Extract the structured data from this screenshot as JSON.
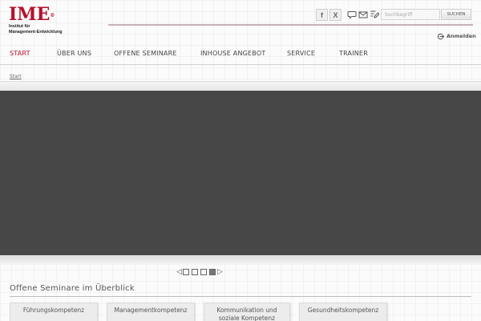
{
  "logo": {
    "mark": "IME",
    "registered": "®",
    "line1": "Institut für",
    "line2": "Management-Entwicklung"
  },
  "social": {
    "facebook": "f",
    "xing": "X"
  },
  "header_icons": [
    "chat-icon",
    "mail-icon",
    "edit-icon"
  ],
  "search": {
    "placeholder": "Suchbegriff",
    "button": "SUCHEN"
  },
  "login": {
    "label": "Anmelden",
    "icon": "login-arrow-icon"
  },
  "nav": {
    "items": [
      {
        "label": "START",
        "active": true
      },
      {
        "label": "ÜBER UNS",
        "active": false
      },
      {
        "label": "OFFENE SEMINARE",
        "active": false
      },
      {
        "label": "INHOUSE ANGEBOT",
        "active": false
      },
      {
        "label": "SERVICE",
        "active": false
      },
      {
        "label": "TRAINER",
        "active": false
      }
    ]
  },
  "breadcrumb": "Start",
  "slider": {
    "slide_count": 4,
    "active_slide": 4
  },
  "overview": {
    "title": "Offene Seminare im Überblick",
    "cards": [
      {
        "line1": "Führungskompetenz",
        "line2": ""
      },
      {
        "line1": "Managementkompetenz",
        "line2": ""
      },
      {
        "line1": "Kommunikation und",
        "line2": "soziale Kompetenz"
      },
      {
        "line1": "Gesundheitskompetenz",
        "line2": ""
      }
    ]
  },
  "colors": {
    "brand": "#b5122c",
    "slider_bg": "#474747",
    "text": "#444444"
  }
}
